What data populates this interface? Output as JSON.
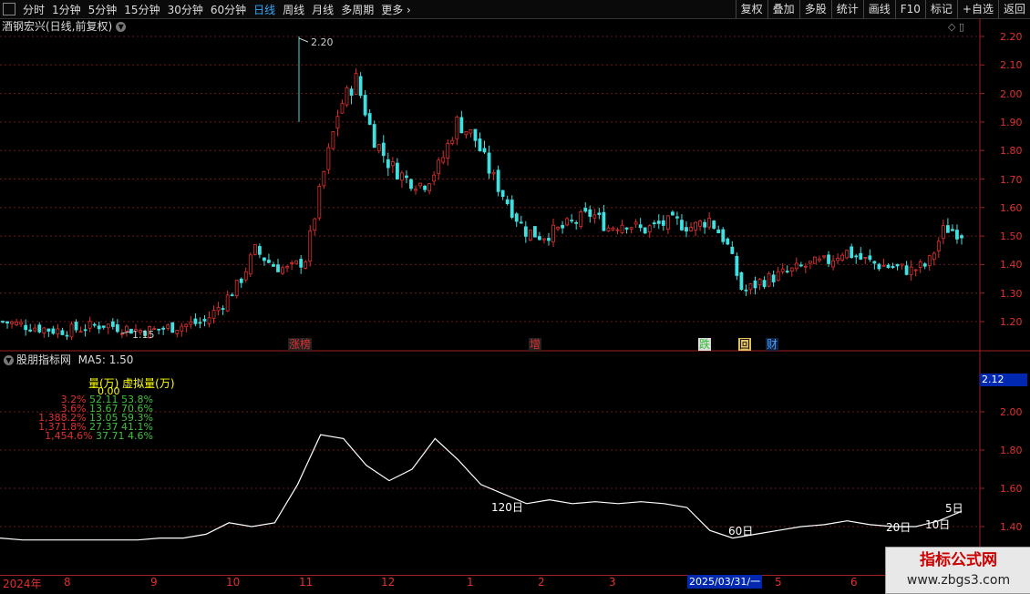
{
  "toolbar": {
    "periods": [
      "分时",
      "1分钟",
      "5分钟",
      "15分钟",
      "30分钟",
      "60分钟",
      "日线",
      "周线",
      "月线",
      "多周期",
      "更多"
    ],
    "active_index": 6,
    "right_buttons": [
      "复权",
      "叠加",
      "多股",
      "统计",
      "画线",
      "F10",
      "标记",
      "+自选",
      "返回"
    ]
  },
  "chart_title": "酒钢宏兴(日线,前复权)",
  "indicator_title": "股朋指标网",
  "ma_label": "MA5: 1.50",
  "price_tag": "2.12",
  "high_label": "2.20",
  "low_label": "1.15",
  "main_axis_ticks": [
    "2.20",
    "2.10",
    "2.00",
    "1.90",
    "1.80",
    "1.70",
    "1.60",
    "1.50",
    "1.40",
    "1.30",
    "1.20"
  ],
  "sub_axis_ticks": [
    "2.00",
    "1.80",
    "1.60",
    "1.40"
  ],
  "volume_table": {
    "header": "量(万)  虚拟量(万)",
    "zero": "0.00",
    "rows": [
      {
        "pct": "3.2%",
        "vol": "52.11",
        "vpct": "53.8%"
      },
      {
        "pct": "3.6%",
        "vol": "13.67",
        "vpct": "70.6%"
      },
      {
        "pct": "1,388.2%",
        "vol": "13.05",
        "vpct": "59.3%"
      },
      {
        "pct": "1,371.8%",
        "vol": "27.37",
        "vpct": "41.1%"
      },
      {
        "pct": "1,454.6%",
        "vol": "37.71",
        "vpct": "4.6%"
      }
    ]
  },
  "ma_labels": [
    "120日",
    "60日",
    "20日",
    "10日",
    "5日"
  ],
  "event_marks": [
    {
      "text": "涨榜",
      "color": "#e03030",
      "bg": "#222"
    },
    {
      "text": "增",
      "color": "#e03030",
      "bg": "#222"
    },
    {
      "text": "跌",
      "color": "#30c030",
      "bg": "#ddd"
    },
    {
      "text": "回",
      "color": "#000",
      "bg": "#e0c060"
    },
    {
      "text": "财",
      "color": "#4aa0ff",
      "bg": "#102040"
    }
  ],
  "x_axis": [
    "2024年",
    "8",
    "9",
    "10",
    "11",
    "12",
    "1",
    "2",
    "3",
    "2025/03/31/一",
    "5",
    "6"
  ],
  "watermark": {
    "line1": "指标公式网",
    "line2": "www.zbgs3.com"
  },
  "colors": {
    "up": "#e03030",
    "down": "#40e0e0",
    "ma": "#ffffff"
  },
  "chart_data": {
    "type": "candlestick",
    "title": "酒钢宏兴(日线,前复权)",
    "x_ticks": [
      "2024年",
      "8",
      "9",
      "10",
      "11",
      "12",
      "1",
      "2",
      "3",
      "2025/03/31/一",
      "5",
      "6"
    ],
    "y_range": [
      1.15,
      2.22
    ],
    "high": 2.2,
    "low": 1.15,
    "close_path": [
      1.2,
      1.19,
      1.18,
      1.17,
      1.17,
      1.18,
      1.19,
      1.18,
      1.17,
      1.17,
      1.18,
      1.19,
      1.2,
      1.26,
      1.33,
      1.45,
      1.4,
      1.38,
      1.42,
      1.7,
      1.95,
      2.05,
      1.85,
      1.75,
      1.7,
      1.68,
      1.75,
      1.9,
      1.85,
      1.72,
      1.62,
      1.52,
      1.5,
      1.52,
      1.55,
      1.58,
      1.53,
      1.55,
      1.52,
      1.54,
      1.55,
      1.53,
      1.56,
      1.48,
      1.3,
      1.34,
      1.36,
      1.38,
      1.4,
      1.41,
      1.45,
      1.42,
      1.4,
      1.39,
      1.38,
      1.4,
      1.53,
      1.51
    ],
    "ma120_path": [
      1.34,
      1.33,
      1.33,
      1.33,
      1.33,
      1.33,
      1.33,
      1.34,
      1.34,
      1.36,
      1.42,
      1.4,
      1.42,
      1.62,
      1.88,
      1.86,
      1.72,
      1.64,
      1.7,
      1.86,
      1.75,
      1.62,
      1.57,
      1.52,
      1.54,
      1.52,
      1.53,
      1.52,
      1.53,
      1.52,
      1.5,
      1.38,
      1.34,
      1.36,
      1.38,
      1.4,
      1.41,
      1.43,
      1.41,
      1.4,
      1.4,
      1.43,
      1.48
    ]
  }
}
